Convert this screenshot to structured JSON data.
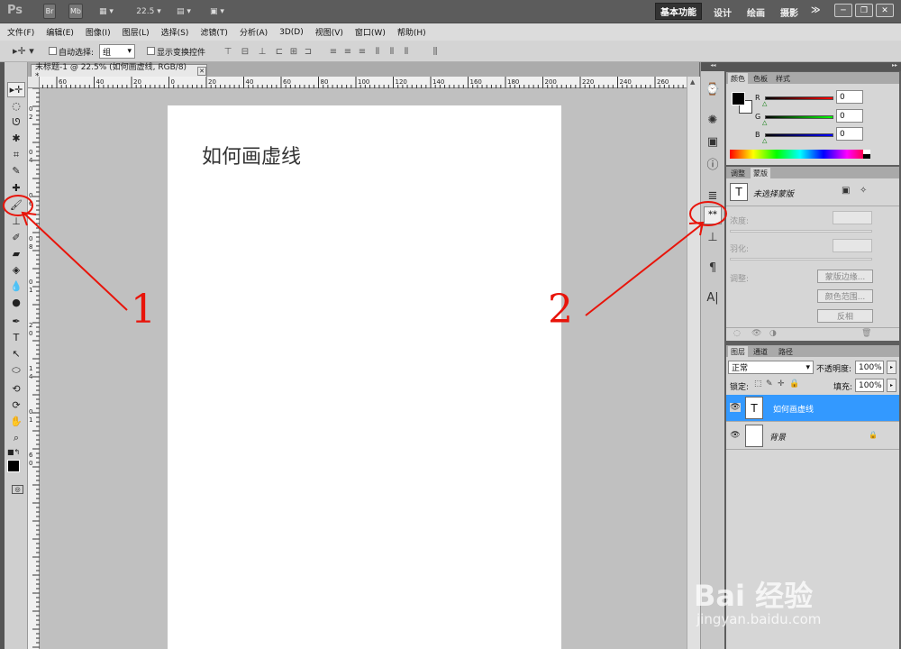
{
  "titlebar": {
    "app_logo": "Ps",
    "br_label": "Br",
    "mb_label": "Mb",
    "zoom": "22.5",
    "workspaces": [
      "基本功能",
      "设计",
      "绘画",
      "摄影"
    ],
    "more_label": "≫"
  },
  "menu": [
    "文件(F)",
    "编辑(E)",
    "图像(I)",
    "图层(L)",
    "选择(S)",
    "滤镜(T)",
    "分析(A)",
    "3D(D)",
    "视图(V)",
    "窗口(W)",
    "帮助(H)"
  ],
  "options": {
    "auto_select_label": "自动选择:",
    "auto_select_value": "组",
    "show_transform_label": "显示变换控件"
  },
  "document": {
    "tab_title": "未标题-1 @ 22.5% (如何画虚线, RGB/8) *",
    "close_glyph": "✕",
    "canvas_text": "如何画虚线"
  },
  "ruler_top": [
    "60",
    "40",
    "20",
    "0",
    "20",
    "40",
    "60",
    "80",
    "100",
    "120",
    "140",
    "160",
    "180",
    "200",
    "220",
    "240",
    "260"
  ],
  "ruler_left": [
    "0",
    "2",
    "0",
    "4",
    "0",
    "6",
    "0",
    "8",
    "0",
    "1",
    "2",
    "0",
    "1",
    "4",
    "0",
    "1",
    "6",
    "0"
  ],
  "color_panel": {
    "tabs": [
      "颜色",
      "色板",
      "样式"
    ],
    "r_label": "R",
    "g_label": "G",
    "b_label": "B",
    "r_value": "0",
    "g_value": "0",
    "b_value": "0"
  },
  "mask_panel": {
    "tabs": [
      "调整",
      "蒙版"
    ],
    "title": "未选择蒙版",
    "density_label": "浓度:",
    "feather_label": "羽化:",
    "refine_label": "调整:",
    "edge_button": "蒙版边缘...",
    "color_range_button": "颜色范围...",
    "invert_button": "反相"
  },
  "layers_panel": {
    "tabs": [
      "图层",
      "通道",
      "路径"
    ],
    "blend_mode": "正常",
    "opacity_label": "不透明度:",
    "opacity_value": "100%",
    "lock_label": "锁定:",
    "fill_label": "填充:",
    "fill_value": "100%",
    "layers": [
      {
        "name": "如何画虚线",
        "thumb": "T",
        "selected": true
      },
      {
        "name": "背景",
        "thumb": "",
        "selected": false
      }
    ]
  },
  "annotations": {
    "one": "1",
    "two": "2"
  },
  "watermark": {
    "logo": "Bai 经验",
    "url": "jingyan.baidu.com"
  },
  "colors": {
    "annotation_red": "#e8140a",
    "layer_selected": "#3399ff"
  }
}
